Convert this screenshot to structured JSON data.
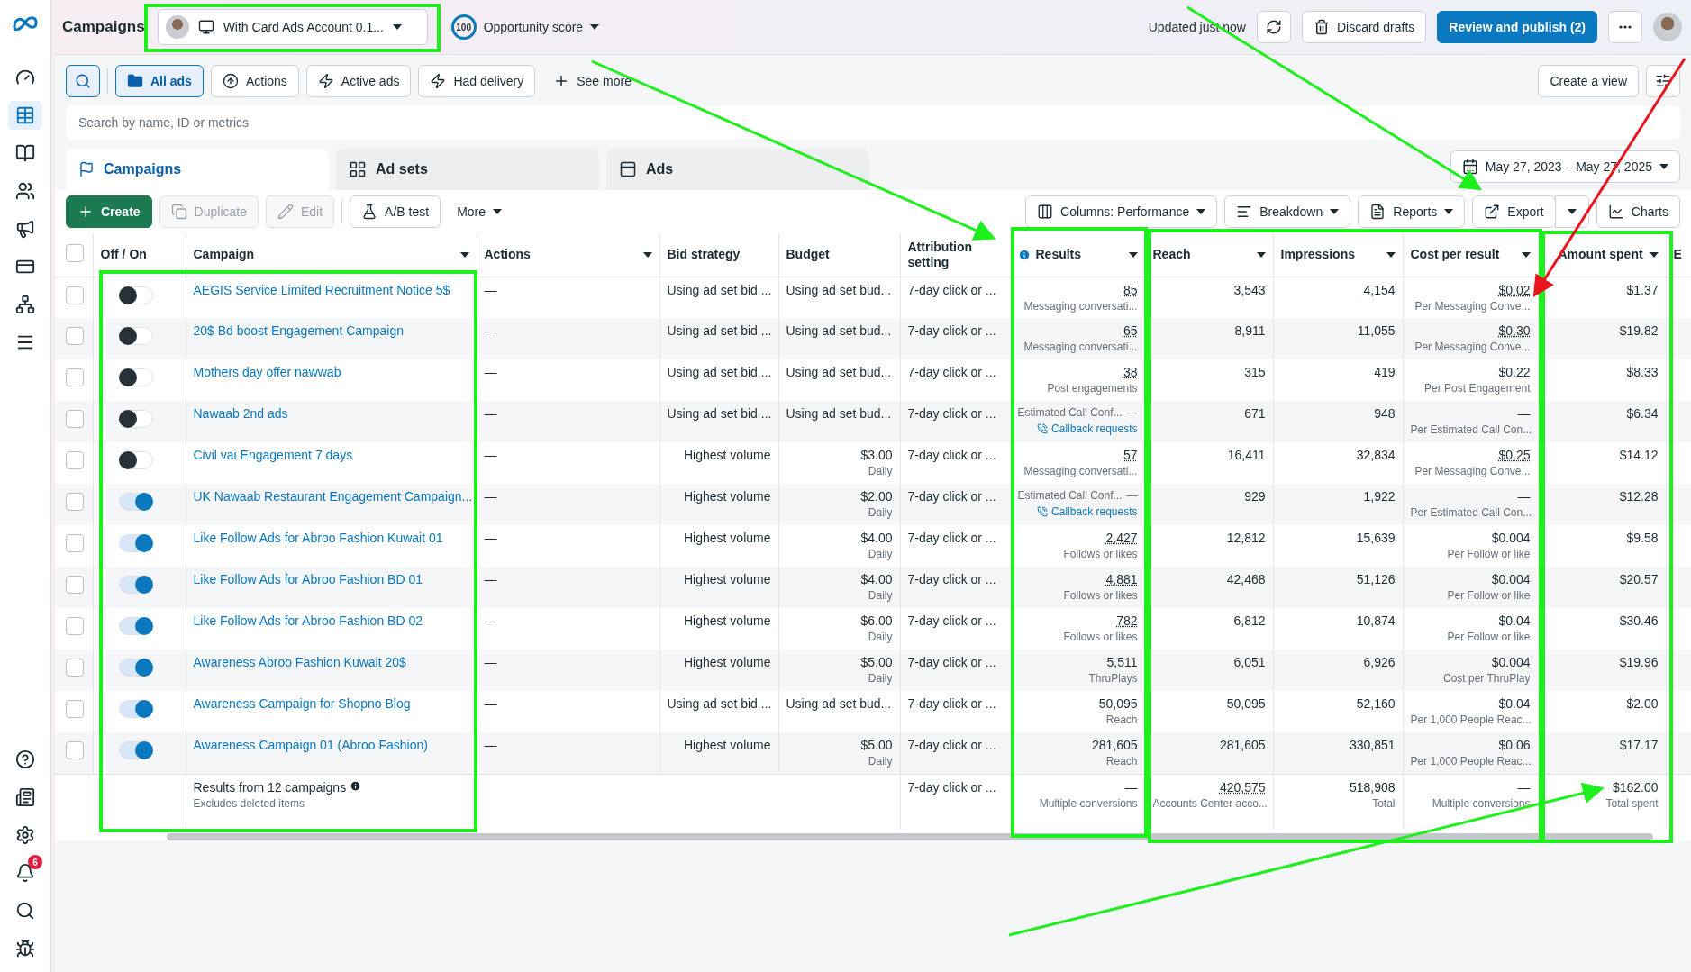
{
  "header": {
    "title": "Campaigns",
    "account": "With Card Ads Account 0.1...",
    "score": "100",
    "score_label": "Opportunity score",
    "updated": "Updated just now",
    "discard": "Discard drafts",
    "publish": "Review and publish (2)"
  },
  "filters": [
    {
      "label": "All ads",
      "kind": "folder",
      "selected": true
    },
    {
      "label": "Actions",
      "kind": "upload",
      "selected": false
    },
    {
      "label": "Active ads",
      "kind": "bolt",
      "selected": false
    },
    {
      "label": "Had delivery",
      "kind": "bolt",
      "selected": false
    }
  ],
  "see_more": "See more",
  "create_view": "Create a view",
  "search": {
    "placeholder": "Search by name, ID or metrics"
  },
  "level_tabs": [
    {
      "label": "Campaigns",
      "kind": "campaign",
      "selected": true
    },
    {
      "label": "Ad sets",
      "kind": "grid",
      "selected": false
    },
    {
      "label": "Ads",
      "kind": "ad",
      "selected": false
    }
  ],
  "date_range": "May 27, 2023 – May 27, 2025",
  "actions_left": [
    {
      "label": "Create",
      "kind": "create",
      "disabled": false
    },
    {
      "label": "Duplicate",
      "kind": "duplicate",
      "disabled": true
    },
    {
      "label": "Edit",
      "kind": "edit",
      "disabled": true
    },
    {
      "label": "A/B test",
      "kind": "abtest",
      "disabled": false
    },
    {
      "label": "More",
      "kind": "more",
      "disabled": false
    }
  ],
  "actions_right": [
    {
      "label": "Columns: Performance",
      "kind": "columns"
    },
    {
      "label": "Breakdown",
      "kind": "breakdown"
    },
    {
      "label": "Reports",
      "kind": "reports"
    },
    {
      "label": "Export",
      "kind": "export"
    },
    {
      "label": "Charts",
      "kind": "charts"
    }
  ],
  "select_all": {
    "checked": false
  },
  "columns": [
    {
      "label": "Off / On",
      "menu": false
    },
    {
      "label": "Campaign",
      "menu": true
    },
    {
      "label": "Actions",
      "menu": true
    },
    {
      "label": "Bid strategy",
      "menu": false
    },
    {
      "label": "Budget",
      "menu": false
    },
    {
      "label": "Attribution setting",
      "menu": false
    },
    {
      "label": "Results",
      "menu": true
    },
    {
      "label": "Reach",
      "menu": true
    },
    {
      "label": "Impressions",
      "menu": true
    },
    {
      "label": "Cost per result",
      "menu": true
    },
    {
      "label": "Amount spent",
      "menu": true
    },
    {
      "label": "E",
      "menu": false
    }
  ],
  "rows": [
    {
      "checked": false,
      "on": false,
      "name": "AEGIS Service Limited Recruitment Notice 5$",
      "actions": "—",
      "bid": "Using ad set bid ...",
      "budget": "Using ad set bud...",
      "attribution": "7-day click or ...",
      "result": {
        "kind": "value",
        "value": "85",
        "underlined": true,
        "label": "Messaging conversati..."
      },
      "reach": "3,543",
      "impressions": "4,154",
      "cost": {
        "value": "$0.02",
        "underlined": true,
        "label": "Per Messaging Conve..."
      },
      "spent": "$1.37"
    },
    {
      "checked": false,
      "on": false,
      "name": "20$ Bd boost Engagement Campaign",
      "actions": "—",
      "bid": "Using ad set bid ...",
      "budget": "Using ad set bud...",
      "attribution": "7-day click or ...",
      "result": {
        "kind": "value",
        "value": "65",
        "underlined": true,
        "label": "Messaging conversati..."
      },
      "reach": "8,911",
      "impressions": "11,055",
      "cost": {
        "value": "$0.30",
        "underlined": true,
        "label": "Per Messaging Conve..."
      },
      "spent": "$19.82"
    },
    {
      "checked": false,
      "on": false,
      "name": "Mothers day offer nawwab",
      "actions": "—",
      "bid": "Using ad set bid ...",
      "budget": "Using ad set bud...",
      "attribution": "7-day click or ...",
      "result": {
        "kind": "value",
        "value": "38",
        "underlined": true,
        "label": "Post engagements"
      },
      "reach": "315",
      "impressions": "419",
      "cost": {
        "value": "$0.22",
        "underlined": false,
        "label": "Per Post Engagement"
      },
      "spent": "$8.33"
    },
    {
      "checked": false,
      "on": false,
      "name": "Nawaab 2nd ads",
      "actions": "—",
      "bid": "Using ad set bid ...",
      "budget": "Using ad set bud...",
      "attribution": "7-day click or ...",
      "result": {
        "kind": "call",
        "label": "Estimated Call Conf...",
        "value": "—",
        "link": "Callback requests"
      },
      "reach": "671",
      "impressions": "948",
      "cost": {
        "value": "—",
        "underlined": false,
        "label": "Per Estimated Call Con..."
      },
      "spent": "$6.34"
    },
    {
      "checked": false,
      "on": false,
      "name": "Civil vai Engagement 7 days",
      "actions": "—",
      "bid": "Highest volume",
      "budget": "$3.00",
      "budget_note": "Daily",
      "attribution": "7-day click or ...",
      "result": {
        "kind": "value",
        "value": "57",
        "underlined": true,
        "label": "Messaging conversati..."
      },
      "reach": "16,411",
      "impressions": "32,834",
      "cost": {
        "value": "$0.25",
        "underlined": true,
        "label": "Per Messaging Conve..."
      },
      "spent": "$14.12"
    },
    {
      "checked": false,
      "on": true,
      "name": "UK Nawaab Restaurant Engagement Campaign...",
      "actions": "—",
      "bid": "Highest volume",
      "budget": "$2.00",
      "budget_note": "Daily",
      "attribution": "7-day click or ...",
      "result": {
        "kind": "call",
        "label": "Estimated Call Conf...",
        "value": "—",
        "link": "Callback requests"
      },
      "reach": "929",
      "impressions": "1,922",
      "cost": {
        "value": "—",
        "underlined": false,
        "label": "Per Estimated Call Con..."
      },
      "spent": "$12.28"
    },
    {
      "checked": false,
      "on": true,
      "name": "Like Follow Ads for Abroo Fashion Kuwait 01",
      "actions": "—",
      "bid": "Highest volume",
      "budget": "$4.00",
      "budget_note": "Daily",
      "attribution": "7-day click or ...",
      "result": {
        "kind": "value",
        "value": "2,427",
        "underlined": true,
        "label": "Follows or likes"
      },
      "reach": "12,812",
      "impressions": "15,639",
      "cost": {
        "value": "$0.004",
        "underlined": false,
        "label": "Per Follow or like"
      },
      "spent": "$9.58"
    },
    {
      "checked": false,
      "on": true,
      "name": "Like Follow Ads for Abroo Fashion BD 01",
      "actions": "—",
      "bid": "Highest volume",
      "budget": "$4.00",
      "budget_note": "Daily",
      "attribution": "7-day click or ...",
      "result": {
        "kind": "value",
        "value": "4,881",
        "underlined": true,
        "label": "Follows or likes"
      },
      "reach": "42,468",
      "impressions": "51,126",
      "cost": {
        "value": "$0.004",
        "underlined": false,
        "label": "Per Follow or like"
      },
      "spent": "$20.57"
    },
    {
      "checked": false,
      "on": true,
      "name": "Like Follow Ads for Abroo Fashion BD 02",
      "actions": "—",
      "bid": "Highest volume",
      "budget": "$6.00",
      "budget_note": "Daily",
      "attribution": "7-day click or ...",
      "result": {
        "kind": "value",
        "value": "782",
        "underlined": true,
        "label": "Follows or likes"
      },
      "reach": "6,812",
      "impressions": "10,874",
      "cost": {
        "value": "$0.04",
        "underlined": false,
        "label": "Per Follow or like"
      },
      "spent": "$30.46"
    },
    {
      "checked": false,
      "on": true,
      "name": "Awareness Abroo Fashion Kuwait 20$",
      "actions": "—",
      "bid": "Highest volume",
      "budget": "$5.00",
      "budget_note": "Daily",
      "attribution": "7-day click or ...",
      "result": {
        "kind": "value",
        "value": "5,511",
        "underlined": false,
        "label": "ThruPlays"
      },
      "reach": "6,051",
      "impressions": "6,926",
      "cost": {
        "value": "$0.004",
        "underlined": false,
        "label": "Cost per ThruPlay"
      },
      "spent": "$19.96"
    },
    {
      "checked": false,
      "on": true,
      "name": "Awareness Campaign for Shopno Blog",
      "actions": "—",
      "bid": "Using ad set bid ...",
      "budget": "Using ad set bud...",
      "attribution": "7-day click or ...",
      "result": {
        "kind": "value",
        "value": "50,095",
        "underlined": false,
        "label": "Reach"
      },
      "reach": "50,095",
      "impressions": "52,160",
      "cost": {
        "value": "$0.04",
        "underlined": false,
        "label": "Per 1,000 People Reac..."
      },
      "spent": "$2.00"
    },
    {
      "checked": false,
      "on": true,
      "name": "Awareness Campaign 01 (Abroo Fashion)",
      "actions": "—",
      "bid": "Highest volume",
      "budget": "$5.00",
      "budget_note": "Daily",
      "attribution": "7-day click or ...",
      "result": {
        "kind": "value",
        "value": "281,605",
        "underlined": false,
        "label": "Reach"
      },
      "reach": "281,605",
      "impressions": "330,851",
      "cost": {
        "value": "$0.06",
        "underlined": false,
        "label": "Per 1,000 People Reac..."
      },
      "spent": "$17.17"
    }
  ],
  "summary": {
    "title": "Results from 12 campaigns",
    "note": "Excludes deleted items",
    "attribution": "7-day click or ...",
    "result": "—",
    "result_label": "Multiple conversions",
    "reach": "420,575",
    "reach_label": "Accounts Center acco...",
    "impressions": "518,908",
    "impressions_label": "Total",
    "cost": "—",
    "cost_label": "Multiple conversions",
    "spent": "$162.00",
    "spent_label": "Total spent"
  },
  "notifications": "6"
}
